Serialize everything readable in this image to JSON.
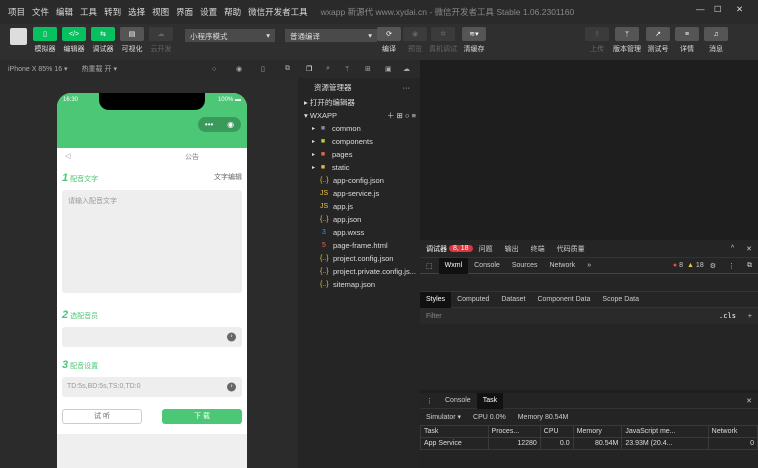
{
  "menu": [
    "项目",
    "文件",
    "编辑",
    "工具",
    "转到",
    "选择",
    "视图",
    "界面",
    "设置",
    "帮助",
    "微信开发者工具"
  ],
  "window_title": "wxapp 新源代 www.xydai.cn - 微信开发者工具 Stable 1.06.2301160",
  "toolbar": {
    "simulator": "模拟器",
    "editor": "编辑器",
    "debugger": "调试器",
    "visual": "可视化",
    "cloud": "云开发",
    "mode": "小程序模式",
    "compile_mode": "普通编译",
    "compile": "编译",
    "preview": "预览",
    "real_debug": "真机调试",
    "clear_cache": "清缓存",
    "upload": "上传",
    "version": "版本管理",
    "test": "测试号",
    "details": "详情",
    "messages": "消息"
  },
  "subbar": {
    "device": "iPhone X 85% 16 ▾",
    "hot_reload": "热重载 开 ▾"
  },
  "phone": {
    "time": "16:30",
    "battery": "100%",
    "notice": "公告",
    "s1_num": "1",
    "s1": "配音文字",
    "s1_right": "文字编辑",
    "textarea_placeholder": "请输入配音文字",
    "s2_num": "2",
    "s2": "选配音员",
    "s3_num": "3",
    "s3": "配音设置",
    "settings_value": "TD:5s,BD:5s,TS:0,TD:0",
    "listen": "试 听",
    "download": "下 载"
  },
  "tree": {
    "header": "资源管理器",
    "open_editors": "打开的编辑器",
    "root": "WXAPP",
    "items": [
      {
        "name": "common",
        "icon": "folder",
        "color": "#7b8fa8"
      },
      {
        "name": "components",
        "icon": "folder",
        "color": "#b5d334"
      },
      {
        "name": "pages",
        "icon": "folder",
        "color": "#e5664e"
      },
      {
        "name": "static",
        "icon": "folder",
        "color": "#e8b33d"
      },
      {
        "name": "app-config.json",
        "icon": "{..}",
        "color": "#e8c33d"
      },
      {
        "name": "app-service.js",
        "icon": "JS",
        "color": "#e8c33d"
      },
      {
        "name": "app.js",
        "icon": "JS",
        "color": "#e8c33d"
      },
      {
        "name": "app.json",
        "icon": "{..}",
        "color": "#e8c33d"
      },
      {
        "name": "app.wxss",
        "icon": "3",
        "color": "#3d8fe8"
      },
      {
        "name": "page-frame.html",
        "icon": "5",
        "color": "#e5664e"
      },
      {
        "name": "project.config.json",
        "icon": "{..}",
        "color": "#e8c33d"
      },
      {
        "name": "project.private.config.js...",
        "icon": "{..}",
        "color": "#e8c33d"
      },
      {
        "name": "sitemap.json",
        "icon": "{..}",
        "color": "#e8c33d"
      }
    ]
  },
  "debugger": {
    "tabs": [
      "调试器",
      "问题",
      "输出",
      "终端",
      "代码质量"
    ],
    "badge": "8, 18",
    "devtabs": [
      "Wxml",
      "Console",
      "Sources",
      "Network",
      "»"
    ],
    "errors": "8",
    "warnings": "18",
    "subtabs": [
      "Styles",
      "Computed",
      "Dataset",
      "Component Data",
      "Scope Data"
    ],
    "filter": "Filter",
    "cls": ".cls"
  },
  "task": {
    "tabs": [
      "Console",
      "Task"
    ],
    "simulator": "Simulator ▾",
    "cpu": "CPU 0.0%",
    "memory": "Memory 80.54M",
    "columns": [
      "Task",
      "Proces...",
      "CPU",
      "Memory",
      "JavaScript me...",
      "Network"
    ],
    "rows": [
      [
        "App Service",
        "12280",
        "0.0",
        "80.54M",
        "23.93M (20.4...",
        "0"
      ]
    ]
  }
}
